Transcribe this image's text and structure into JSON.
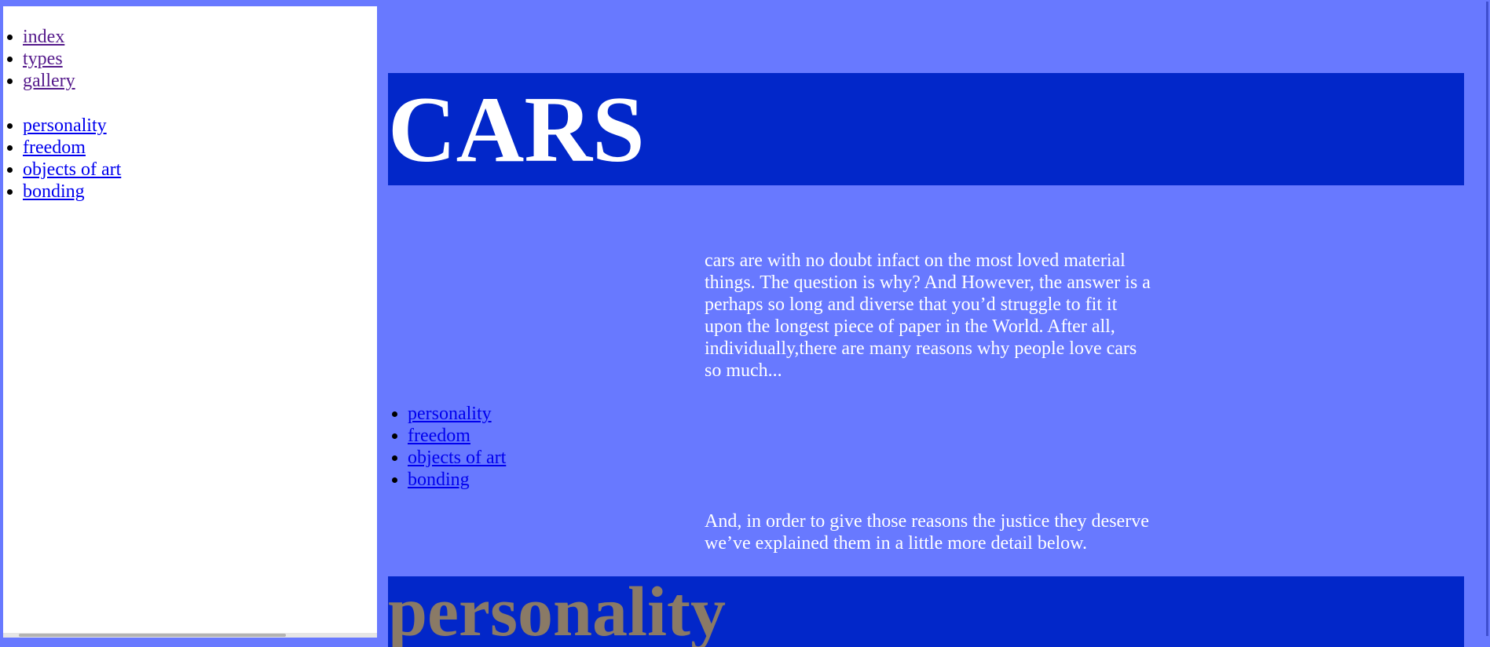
{
  "sidebar": {
    "primary_nav": [
      {
        "label": "index"
      },
      {
        "label": "types"
      },
      {
        "label": "gallery"
      }
    ],
    "section_nav": [
      {
        "label": "personality"
      },
      {
        "label": "freedom"
      },
      {
        "label": "objects of art"
      },
      {
        "label": "bonding"
      }
    ]
  },
  "header": {
    "title": "CARS"
  },
  "main": {
    "intro_paragraph": "cars are with no doubt infact on the most loved material things. The question is why? And However, the answer is a perhaps so long and diverse that you’d struggle to fit it upon the longest piece of paper in the World. After all, individually,there are many reasons why people love cars so much...",
    "section_links": [
      {
        "label": "personality"
      },
      {
        "label": "freedom"
      },
      {
        "label": "objects of art"
      },
      {
        "label": "bonding"
      }
    ],
    "followup_paragraph": "And, in order to give those reasons the justice they deserve we’ve explained them in a little more detail below.",
    "section_heading": "personality"
  },
  "colors": {
    "page_background": "#6879ff",
    "banner_background": "#0227c9",
    "sidebar_background": "#ffffff",
    "visited_link": "#551a8b",
    "link": "#0000ee",
    "section_heading_text": "#8a7a66"
  }
}
